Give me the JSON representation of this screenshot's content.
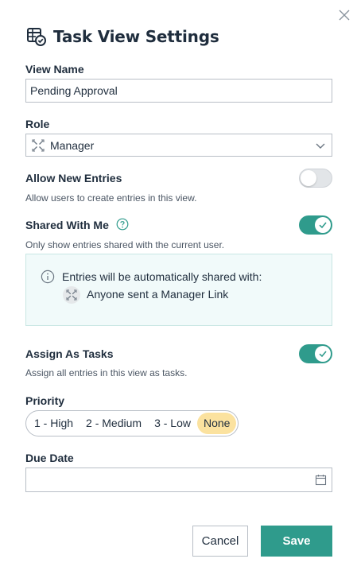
{
  "dialog": {
    "title": "Task View Settings",
    "header_icon": "table-settings-icon",
    "close_icon": "close-icon"
  },
  "view_name": {
    "label": "View Name",
    "value": "Pending Approval"
  },
  "role": {
    "label": "Role",
    "value": "Manager",
    "icon": "role-icon"
  },
  "allow_new_entries": {
    "label": "Allow New Entries",
    "description": "Allow users to create entries in this view.",
    "enabled": false
  },
  "shared_with_me": {
    "label": "Shared With Me",
    "description": "Only show entries shared with the current user.",
    "enabled": true,
    "info": {
      "text": "Entries will be automatically shared with:",
      "share_target": "Anyone sent a Manager Link"
    }
  },
  "assign_as_tasks": {
    "label": "Assign As Tasks",
    "description": "Assign all entries in this view as tasks.",
    "enabled": true
  },
  "priority": {
    "label": "Priority",
    "options": [
      "1 - High",
      "2 - Medium",
      "3 - Low",
      "None"
    ],
    "selected": "None"
  },
  "due_date": {
    "label": "Due Date",
    "value": ""
  },
  "buttons": {
    "cancel": "Cancel",
    "save": "Save"
  },
  "colors": {
    "accent": "#2f9b8c",
    "selected_option": "#fbe29f",
    "info_bg": "#f1fafa"
  }
}
